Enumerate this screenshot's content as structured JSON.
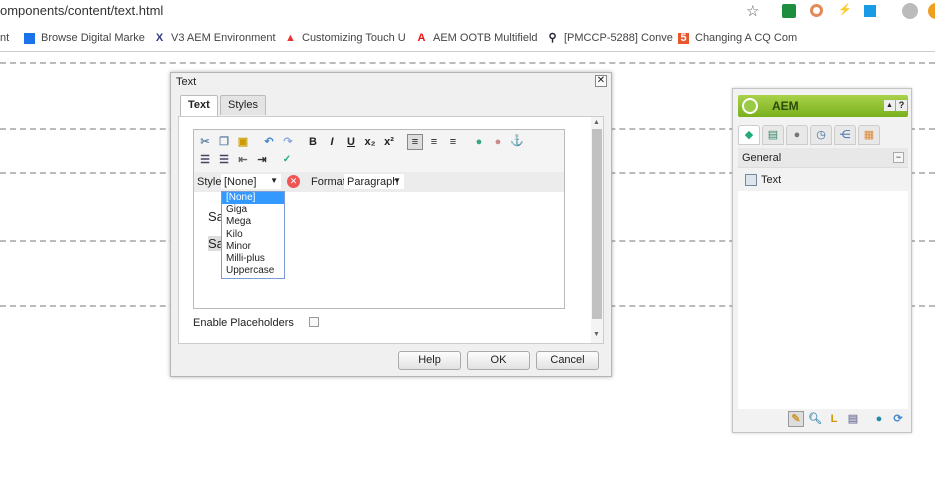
{
  "browser": {
    "url": "omponents/content/text.html",
    "bookmarks": [
      {
        "label": "nt",
        "icon": "generic-icon"
      },
      {
        "label": "Browse Digital Marke",
        "icon": "shield-icon"
      },
      {
        "label": "V3 AEM Environment",
        "icon": "x-logo-icon"
      },
      {
        "label": "Customizing Touch U",
        "icon": "adobe-icon"
      },
      {
        "label": "AEM OOTB Multifield",
        "icon": "adobe-icon"
      },
      {
        "label": "[PMCCP-5288] Conve",
        "icon": "jira-icon"
      },
      {
        "label": "Changing A CQ Com",
        "icon": "html5-icon"
      }
    ]
  },
  "dialog": {
    "title": "Text",
    "tabs": [
      {
        "label": "Text",
        "active": true
      },
      {
        "label": "Styles",
        "active": false
      }
    ],
    "style_label": "Style",
    "style_value": "[None]",
    "format_label": "Format",
    "format_value": "Paragraph",
    "style_options": [
      "[None]",
      "Giga",
      "Mega",
      "Kilo",
      "Minor",
      "Milli-plus",
      "Uppercase"
    ],
    "content_lines": [
      "Sa",
      "Sa"
    ],
    "placeholders_label": "Enable Placeholders",
    "placeholders_checked": false,
    "buttons": {
      "help": "Help",
      "ok": "OK",
      "cancel": "Cancel"
    }
  },
  "sidekick": {
    "title": "AEM",
    "section": "General",
    "items": [
      "Text"
    ]
  }
}
